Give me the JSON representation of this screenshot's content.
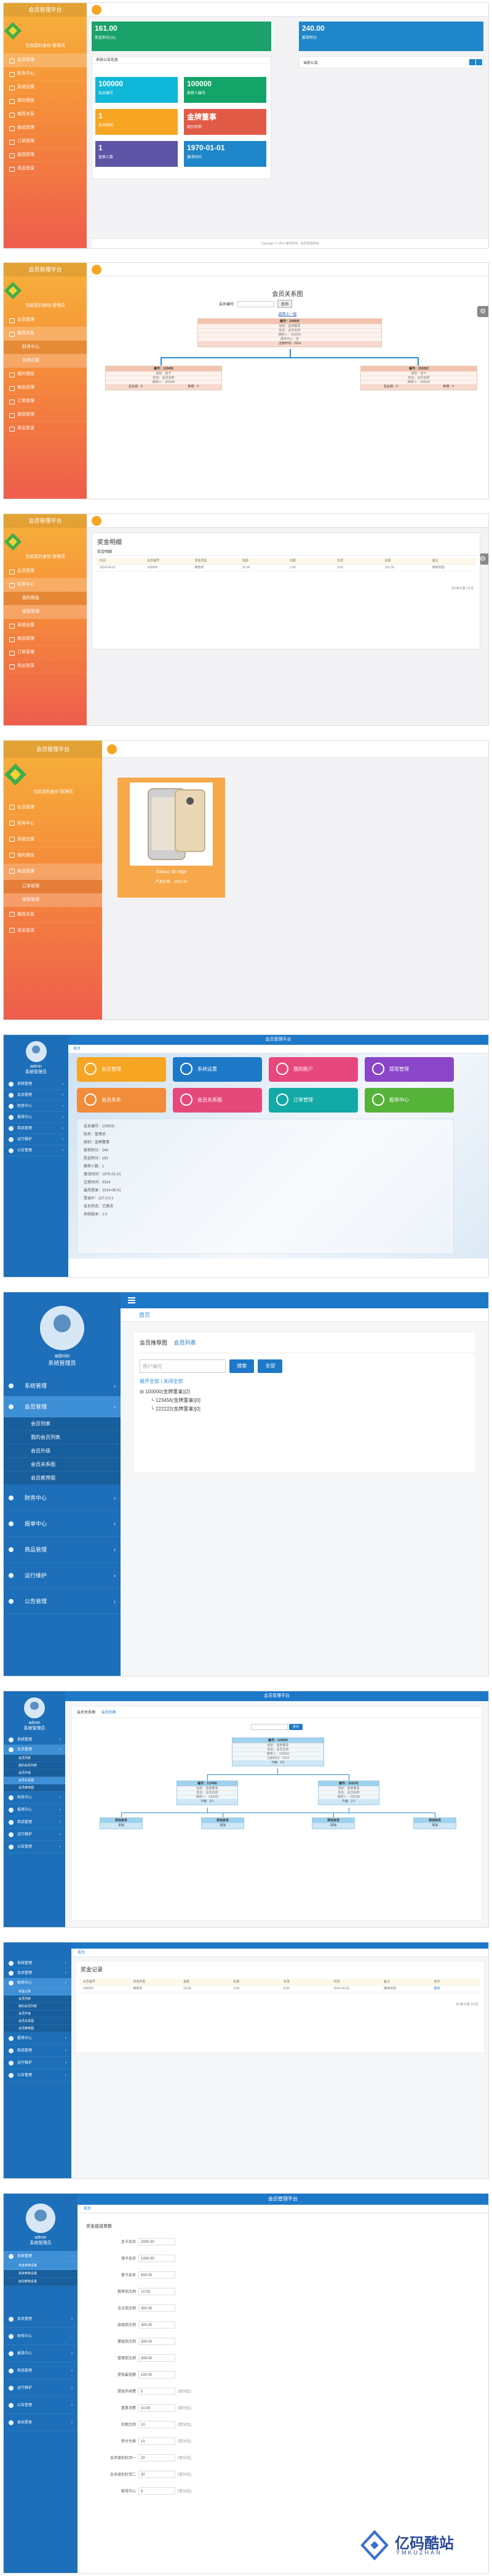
{
  "shot1": {
    "brand": "会员管理平台",
    "role": "当前您的身份:管理员",
    "menu": [
      "会员管理",
      "财务中心",
      "系统设置",
      "我的佣金",
      "推荐关系",
      "商品管理",
      "订单管理",
      "提现管理",
      "退出登录"
    ],
    "tiles": [
      {
        "big": "161.00",
        "sm": "奖金积分(元)",
        "color": "#1aa26a"
      },
      {
        "big": "240.00",
        "sm": "报单积分",
        "color": "#1f87c9"
      },
      {
        "big": "100000",
        "sm": "会员编号",
        "color": "#0fb7d8"
      },
      {
        "big": "100000",
        "sm": "推荐人编号",
        "color": "#13a46a"
      },
      {
        "big": "1",
        "sm": "会员级别",
        "color": "#f6a623"
      },
      {
        "big": "金牌董事",
        "sm": "级别名称",
        "color": "#e05a45"
      },
      {
        "big": "1",
        "sm": "直推人数",
        "color": "#5e55a6"
      },
      {
        "big": "1970-01-01",
        "sm": "激活时间",
        "color": "#1f87c9"
      }
    ],
    "tab": "系统公告信息",
    "notice": "当前公告",
    "footer": "Copyright © 2014 版权所有 · 会员管理系统"
  },
  "shot2": {
    "title": "会员关系图",
    "search_label": "会员编号:",
    "search_btn": "查询",
    "back": "返回上一层",
    "root": {
      "h": "编号：100000",
      "rows": [
        "级别：金牌董事",
        "姓名：会员名称",
        "推荐人：100000",
        "报单中心：否"
      ],
      "f": "注册时间：2014"
    },
    "left": {
      "h": "编号：123456",
      "rows": [
        "级别：普卡",
        "姓名：会员名称",
        "推荐人：100000"
      ],
      "f1": "总业绩：0",
      "f2": "新增：0"
    },
    "right": {
      "h": "编号：222222",
      "rows": [
        "级别：普卡",
        "姓名：会员名称",
        "推荐人：100000"
      ],
      "f1": "总业绩：0",
      "f2": "新增：0"
    }
  },
  "shot3": {
    "title": "奖金明细",
    "tab": "奖金明细",
    "headers": [
      "时间",
      "会员编号",
      "奖金类型",
      "金额",
      "扣税",
      "实发",
      "余额",
      "备注"
    ],
    "row": [
      "2014-06-01",
      "100000",
      "推荐奖",
      "10.00",
      "1.00",
      "9.00",
      "161.00",
      "推荐奖励"
    ],
    "pager": "共1条记录 1/1页"
  },
  "shot4": {
    "product_name": "Galaxy S6 edge",
    "product_price": "产品价格：2000.00"
  },
  "shot5": {
    "title": "会员管理平台",
    "crumb": "首页",
    "tiles": [
      {
        "t": "会员管理",
        "c": "#f6a623"
      },
      {
        "t": "系统设置",
        "c": "#1e78c8"
      },
      {
        "t": "我的账户",
        "c": "#e8477d"
      },
      {
        "t": "提现管理",
        "c": "#8a45c9"
      },
      {
        "t": "会员关系",
        "c": "#f08c3a"
      },
      {
        "t": "会员关系图",
        "c": "#e5497b"
      },
      {
        "t": "订单管理",
        "c": "#12a9a6"
      },
      {
        "t": "报单中心",
        "c": "#56b33a"
      }
    ],
    "info": [
      "会员编号：100000",
      "姓名：管理员",
      "级别：金牌董事",
      "报单积分：240",
      "奖金积分：161",
      "推荐人数：1",
      "激活时间：1970-01-01",
      "注册时间：2014",
      "最后登录：2014-06-01",
      "登录IP：127.0.0.1",
      "会员状态：已激活",
      "系统版本：1.0"
    ]
  },
  "shot6": {
    "user": "admin",
    "role": "系统管理员",
    "menu": [
      "系统管理",
      "会员管理",
      "财务中心",
      "报单中心",
      "商品管理",
      "运行维护",
      "公告管理"
    ],
    "submenu": [
      "会员列表",
      "我的会员列表",
      "会员升级",
      "会员关系图",
      "会员推荐图"
    ],
    "crumb": "首页",
    "tabs": [
      "会员推荐图",
      "会员列表"
    ],
    "input_placeholder": "用户编号",
    "search_btn": "搜索",
    "all_btn": "全部",
    "expand": "展开全部 | 关闭全部",
    "tree": [
      "100000(金牌董事)[2]",
      "123456(金牌董事)[0]",
      "222222(金牌董事)[0]"
    ]
  },
  "shot7": {
    "title": "会员管理平台",
    "user": "admin",
    "role": "系统管理员",
    "tabs": [
      "会员关系图",
      "会员列表"
    ],
    "search_btn": "查询",
    "root": {
      "h": "编号：100000",
      "rows": [
        "级别：金牌董事",
        "姓名：会员名称",
        "推荐人：100000",
        "注册时间：2014"
      ],
      "f": "下级：2人"
    },
    "mid": [
      {
        "h": "编号：123456",
        "rows": [
          "级别：金牌董事",
          "姓名：会员名称",
          "推荐人：100000"
        ],
        "f": "下级：2人"
      },
      {
        "h": "编号：222222",
        "rows": [
          "级别：金牌董事",
          "姓名：会员名称",
          "推荐人：100000"
        ],
        "f": "下级：2人"
      }
    ],
    "leaf": [
      {
        "h": "添加会员",
        "f": "添加"
      },
      {
        "h": "添加会员",
        "f": "添加"
      },
      {
        "h": "添加会员",
        "f": "添加"
      },
      {
        "h": "添加会员",
        "f": "添加"
      }
    ]
  },
  "shot8": {
    "title": "奖金记录",
    "crumb": "首页",
    "headers": [
      "会员编号",
      "奖金类型",
      "金额",
      "扣税",
      "实发",
      "时间",
      "备注",
      "操作"
    ],
    "row": [
      "100000",
      "推荐奖",
      "10.00",
      "1.00",
      "9.00",
      "2014-06-01",
      "推荐奖励",
      "删除"
    ],
    "pager": "共1条记录 1/1页"
  },
  "shot9": {
    "title": "会员管理平台",
    "crumb": "首页",
    "section": "奖金提成参数",
    "submenu": [
      "奖金参数设置",
      "系统参数设置",
      "级别参数设置"
    ],
    "rows": [
      {
        "l": "金卡会员",
        "v": "2000.00",
        "u": ""
      },
      {
        "l": "银卡会员",
        "v": "1000.00",
        "u": ""
      },
      {
        "l": "普卡会员",
        "v": "500.00",
        "u": ""
      },
      {
        "l": "推荐奖比例",
        "v": "10.00",
        "u": ""
      },
      {
        "l": "见点奖比例",
        "v": "300.00",
        "u": ""
      },
      {
        "l": "层碰奖比例",
        "v": "300.00",
        "u": ""
      },
      {
        "l": "量碰奖比例",
        "v": "300.00",
        "u": ""
      },
      {
        "l": "管理奖比例",
        "v": "300.00",
        "u": ""
      },
      {
        "l": "提现最低额",
        "v": "100.00",
        "u": ""
      },
      {
        "l": "提现手续费",
        "v": "5",
        "u": "(百分比)"
      },
      {
        "l": "重复消费",
        "v": "10.00",
        "u": "(百分比)"
      },
      {
        "l": "扣税比例",
        "v": "10",
        "u": "(百分比)"
      },
      {
        "l": "积分兑换",
        "v": "10",
        "u": "(百分比)"
      },
      {
        "l": "会员级别封顶一",
        "v": "20",
        "u": "(百分比)"
      },
      {
        "l": "会员级别封顶二",
        "v": "30",
        "u": "(百分比)"
      },
      {
        "l": "报单中心",
        "v": "5",
        "u": "(百分比)"
      }
    ],
    "watermark": "亿码酷站",
    "watermark_en": "YMKUZHAN"
  }
}
